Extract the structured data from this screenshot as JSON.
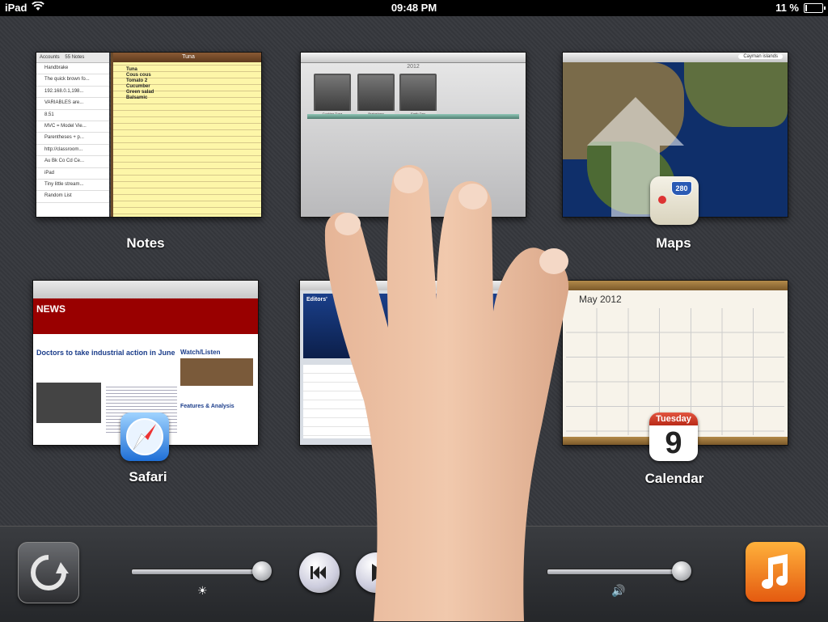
{
  "status_bar": {
    "device": "iPad",
    "time": "09:48 PM",
    "battery": "11 %",
    "battery_level": 0.11
  },
  "apps": {
    "notes": {
      "label": "Notes",
      "list_header": "55 Notes",
      "list_tab": "Accounts",
      "list_items": [
        "Handbrake",
        "The quick brown fo...",
        "192.168.0.1,198...",
        "VARIABLES are...",
        "8.51",
        "MVC = Model Vie...",
        "Parentheses + p...",
        "http://classroom...",
        "Au Bk Co Cd Ce...",
        "iPad",
        "Tiny little stream...",
        "Random List"
      ],
      "note_title": "Tuna",
      "note_lines": [
        "Tuna",
        "Cous cous",
        "Tomato 2",
        "Cucumber",
        "Green salad",
        "Balsamic"
      ]
    },
    "photos": {
      "year": "2012",
      "albums": [
        "Cooking Tuna",
        "Brainstorm",
        "Earth Day"
      ]
    },
    "maps": {
      "label": "Maps",
      "search": "Cayman islands",
      "icon_badge": "280"
    },
    "safari": {
      "label": "Safari",
      "site": "NEWS",
      "headline": "Doctors to take industrial action in June",
      "sidebar_heading": "Watch/Listen",
      "section": "Features & Analysis"
    },
    "appstore": {
      "banner_title": "Editors'"
    },
    "calendar": {
      "label": "Calendar",
      "month": "May 2012",
      "day_name": "Tuesday",
      "day_number": "9"
    }
  },
  "dock": {
    "brightness_level": 0.95,
    "volume_level": 0.98
  }
}
